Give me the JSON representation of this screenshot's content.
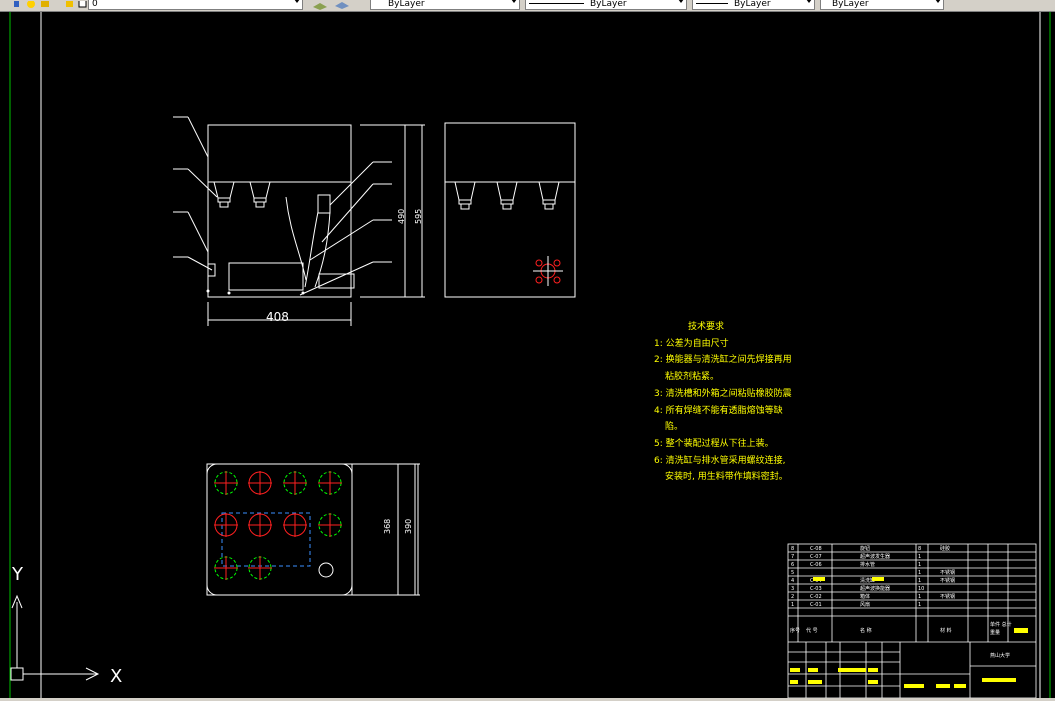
{
  "toolbar": {
    "layer_value": "0",
    "color_value": "ByLayer",
    "linetype_value": "ByLayer",
    "lineweight_value": "ByLayer",
    "plotstyle_value": "ByLayer",
    "icons": [
      "layer-state-icon",
      "sun-icon",
      "lock-icon",
      "color-square-icon",
      "layer-previous-icon",
      "layers-icon"
    ]
  },
  "drawing": {
    "dim_width": "408",
    "dim_height_inner": "490",
    "dim_height_outer": "595",
    "dim_plan_inner": "368",
    "dim_plan_outer": "390",
    "ucs_y": "Y",
    "ucs_x": "X"
  },
  "technical_notes": {
    "title": "技术要求",
    "lines": [
      "1: 公差为自由尺寸",
      "2: 换能器与清洗缸之间先焊接再用",
      "粘胶剂粘紧。",
      "3: 清洗槽和外箱之间粘贴橡胶防震",
      "4: 所有焊缝不能有透脂熔蚀等缺",
      "陷。",
      "5: 整个装配过程从下往上装。",
      "6: 清洗缸与排水管采用螺纹连接,",
      "安装时, 用生料带作填料密封。"
    ]
  },
  "bom": {
    "rows": [
      {
        "no": "8",
        "code": "C-08",
        "name": "旋钮",
        "qty": "8",
        "material": "硅胶"
      },
      {
        "no": "7",
        "code": "C-07",
        "name": "超声波发生器",
        "qty": "1",
        "material": ""
      },
      {
        "no": "6",
        "code": "C-06",
        "name": "排水管",
        "qty": "1",
        "material": ""
      },
      {
        "no": "5",
        "code": "",
        "name": "",
        "qty": "1",
        "material": "不锈钢"
      },
      {
        "no": "4",
        "code": "C-04",
        "name": "清洗缸",
        "qty": "1",
        "material": "不锈钢"
      },
      {
        "no": "3",
        "code": "C-03",
        "name": "超声波换能器",
        "qty": "10",
        "material": ""
      },
      {
        "no": "2",
        "code": "C-02",
        "name": "箱体",
        "qty": "1",
        "material": "不锈钢"
      },
      {
        "no": "1",
        "code": "C-01",
        "name": "风扇",
        "qty": "1",
        "material": ""
      }
    ],
    "header": {
      "no": "序号",
      "code": "代 号",
      "name": "名 称",
      "material": "材 料",
      "mass": "单件 总计",
      "weight": "重量"
    },
    "school": "燕山大学"
  },
  "colors": {
    "background": "#000000",
    "frame_green": "#00c000",
    "geometry_white": "#ffffff",
    "text_yellow": "#ffff00",
    "circle_red": "#ff2020",
    "circle_green": "#00ff00",
    "dashed_blue": "#3a8fff"
  }
}
